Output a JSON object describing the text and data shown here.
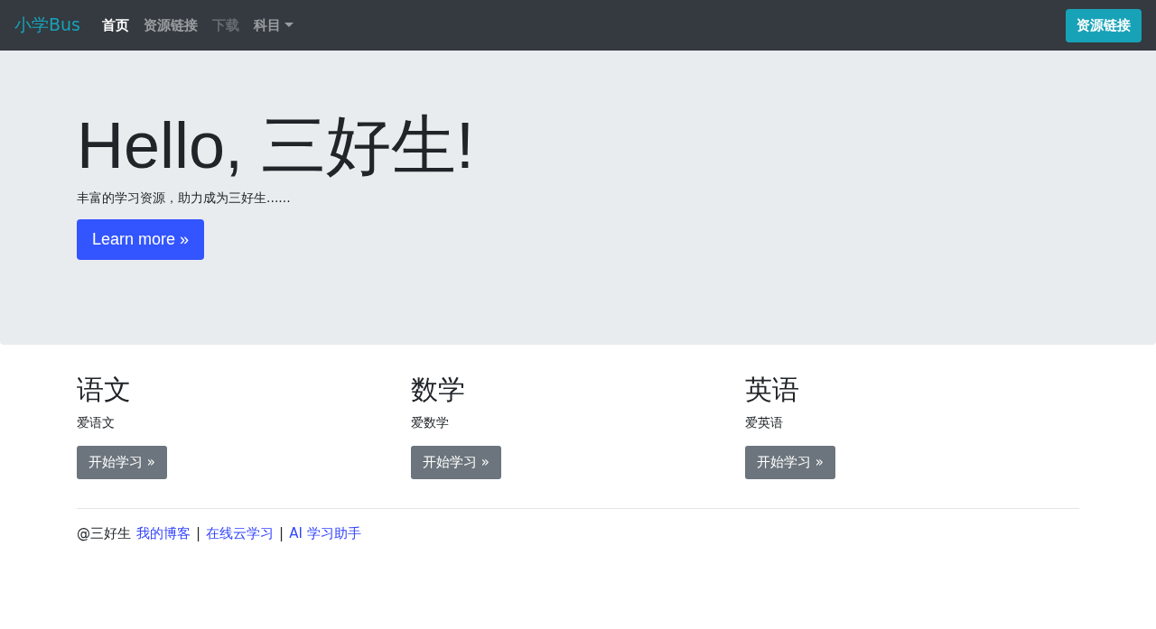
{
  "navbar": {
    "brand": "小学Bus",
    "items": [
      {
        "label": "首页",
        "selected": true,
        "disabled": false,
        "kind": "link"
      },
      {
        "label": "资源链接",
        "selected": false,
        "disabled": false,
        "kind": "link"
      },
      {
        "label": "下载",
        "selected": false,
        "disabled": true,
        "kind": "link"
      },
      {
        "label": "科目",
        "selected": false,
        "disabled": false,
        "kind": "dropdown"
      }
    ],
    "button": "资源链接"
  },
  "hero": {
    "title": "Hello, 三好生!",
    "subtitle": "丰富的学习资源，助力成为三好生......",
    "button": "Learn more »"
  },
  "subjects": [
    {
      "title": "语文",
      "text": "爱语文",
      "button": "开始学习 »"
    },
    {
      "title": "数学",
      "text": "爱数学",
      "button": "开始学习 »"
    },
    {
      "title": "英语",
      "text": "爱英语",
      "button": "开始学习 »"
    }
  ],
  "footer": {
    "owner": "@三好生",
    "links": [
      "我的博客",
      "在线云学习",
      "AI 学习助手"
    ],
    "separator": "|"
  }
}
